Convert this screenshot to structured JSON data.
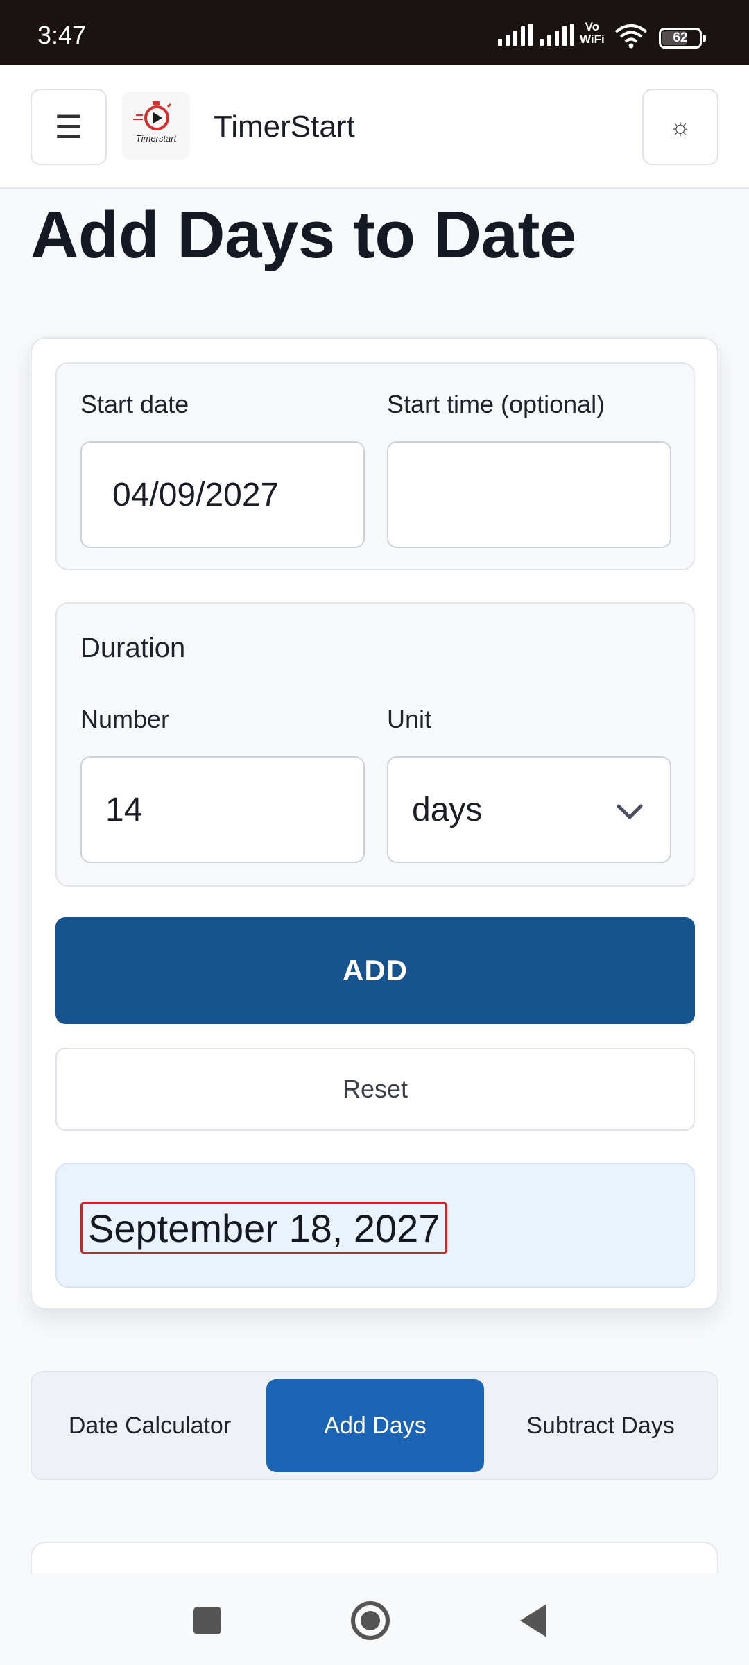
{
  "status_bar": {
    "time": "3:47",
    "vowifi_top": "Vo",
    "vowifi_bottom": "WiFi",
    "battery": "62"
  },
  "header": {
    "menu_icon": "☰",
    "logo_text": "Timerstart",
    "brand": "TimerStart",
    "theme_icon": "☼"
  },
  "page_title": "Add Days to Date",
  "form": {
    "start_date_label": "Start date",
    "start_date_value": "04/09/2027",
    "start_time_label": "Start time (optional)",
    "start_time_value": "",
    "duration_heading": "Duration",
    "number_label": "Number",
    "number_value": "14",
    "unit_label": "Unit",
    "unit_value": "days",
    "add_label": "ADD",
    "reset_label": "Reset",
    "result": "September 18, 2027"
  },
  "tabs": [
    {
      "label": "Date Calculator",
      "active": false
    },
    {
      "label": "Add Days",
      "active": true
    },
    {
      "label": "Subtract Days",
      "active": false
    }
  ],
  "colors": {
    "primary_button": "#16538f",
    "active_tab": "#1b63b3",
    "result_highlight": "#c62828",
    "logo_accent": "#d32f2f"
  }
}
